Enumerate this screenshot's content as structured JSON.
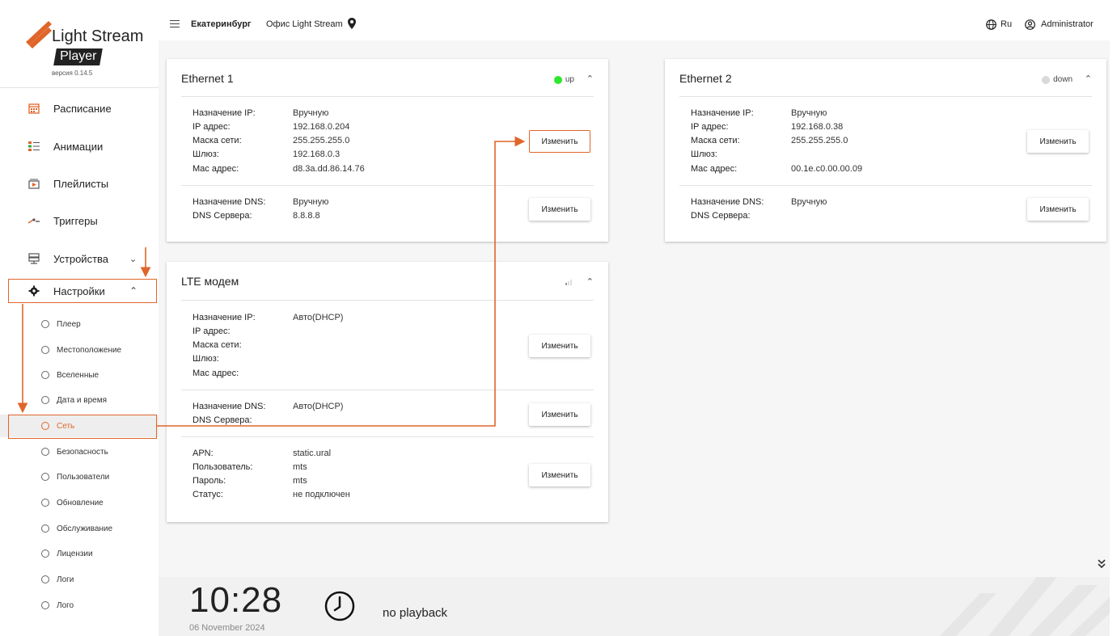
{
  "brand": {
    "name": "Light Stream",
    "product": "Player",
    "version": "версия 0.14.5"
  },
  "topbar": {
    "city": "Екатеринбург",
    "office": "Офис Light Stream",
    "lang": "Ru",
    "user": "Administrator"
  },
  "sidebar": {
    "items": [
      {
        "label": "Расписание",
        "icon": "calendar-icon"
      },
      {
        "label": "Анимации",
        "icon": "animation-icon"
      },
      {
        "label": "Плейлисты",
        "icon": "playlist-icon"
      },
      {
        "label": "Триггеры",
        "icon": "trigger-icon"
      },
      {
        "label": "Устройства",
        "icon": "devices-icon"
      },
      {
        "label": "Настройки",
        "icon": "gear-icon"
      }
    ],
    "settings_sub": [
      {
        "label": "Плеер"
      },
      {
        "label": "Местоположение"
      },
      {
        "label": "Вселенные"
      },
      {
        "label": "Дата и время"
      },
      {
        "label": "Сеть"
      },
      {
        "label": "Безопасность"
      },
      {
        "label": "Пользователи"
      },
      {
        "label": "Обновление"
      },
      {
        "label": "Обслуживание"
      },
      {
        "label": "Лицензии"
      },
      {
        "label": "Логи"
      },
      {
        "label": "Лого"
      }
    ]
  },
  "eth1": {
    "title": "Ethernet 1",
    "status": "up",
    "ip_mode_label": "Назначение IP:",
    "ip_mode": "Вручную",
    "ip_label": "IP адрес:",
    "ip": "192.168.0.204",
    "mask_label": "Маска сети:",
    "mask": "255.255.255.0",
    "gw_label": "Шлюз:",
    "gw": "192.168.0.3",
    "mac_label": "Mac адрес:",
    "mac": "d8.3a.dd.86.14.76",
    "dns_mode_label": "Назначение DNS:",
    "dns_mode": "Вручную",
    "dns_label": "DNS Сервера:",
    "dns": "8.8.8.8",
    "edit": "Изменить"
  },
  "eth2": {
    "title": "Ethernet 2",
    "status": "down",
    "ip_mode_label": "Назначение IP:",
    "ip_mode": "Вручную",
    "ip_label": "IP адрес:",
    "ip": "192.168.0.38",
    "mask_label": "Маска сети:",
    "mask": "255.255.255.0",
    "gw_label": "Шлюз:",
    "mac_label": "Mac адрес:",
    "mac": "00.1e.c0.00.00.09",
    "dns_mode_label": "Назначение DNS:",
    "dns_mode": "Вручную",
    "dns_label": "DNS Сервера:",
    "edit": "Изменить"
  },
  "lte": {
    "title": "LTE модем",
    "ip_mode_label": "Назначение IP:",
    "ip_mode": "Авто(DHCP)",
    "ip_label": "IP адрес:",
    "mask_label": "Маска сети:",
    "gw_label": "Шлюз:",
    "mac_label": "Mac адрес:",
    "dns_mode_label": "Назначение DNS:",
    "dns_mode": "Авто(DHCP)",
    "dns_label": "DNS Сервера:",
    "apn_label": "APN:",
    "apn": "static.ural",
    "user_label": "Пользователь:",
    "user": "mts",
    "pass_label": "Пароль:",
    "pass": "mts",
    "status_label": "Статус:",
    "status": "не подключен",
    "edit": "Изменить"
  },
  "footer": {
    "time": "10:28",
    "date": "06 November 2024",
    "playback": "no playback"
  },
  "colors": {
    "accent": "#e0652a",
    "status_up": "#2ee62e",
    "status_down": "#d9d9d9"
  }
}
